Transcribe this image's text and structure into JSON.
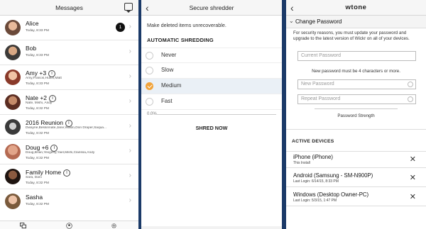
{
  "messages": {
    "title": "Messages",
    "rows": [
      {
        "name": "Alice",
        "members": "",
        "time": "Today, 8:33 PM",
        "badge": "1",
        "info": false
      },
      {
        "name": "Bob",
        "members": "",
        "time": "Today, 8:33 PM",
        "badge": "",
        "info": false
      },
      {
        "name": "Amy +3",
        "members": "Amy,Francis,Hutch,Matt",
        "time": "Today, 8:33 PM",
        "badge": "",
        "info": true
      },
      {
        "name": "Nate +2",
        "members": "Nate, Mishi, Andy",
        "time": "Today, 8:32 PM",
        "badge": "",
        "info": true
      },
      {
        "name": "2016 Reunion",
        "members": "Dwayne,Bessinnate,Jane,Waldo,Don Draper,Saqua...",
        "time": "Today, 8:32 PM",
        "badge": "",
        "info": true
      },
      {
        "name": "Doug +6",
        "members": "Doug,Brian,Yevgeny,Yael,Mishi,Clarissa,Andy",
        "time": "Today, 8:32 PM",
        "badge": "",
        "info": true
      },
      {
        "name": "Family Home",
        "members": "Sara, Dani",
        "time": "Today, 8:32 PM",
        "badge": "",
        "info": true
      },
      {
        "name": "Sasha",
        "members": "",
        "time": "Today, 8:32 PM",
        "badge": "",
        "info": false
      }
    ],
    "tabs": [
      "chat-bubbles-icon",
      "profile-icon",
      "settings-gear-icon"
    ]
  },
  "shredder": {
    "title": "Secure shredder",
    "description": "Make deleted items unrecoverable.",
    "section": "AUTOMATIC SHREDDING",
    "options": [
      "Never",
      "Slow",
      "Medium",
      "Fast"
    ],
    "selected_option": "Medium",
    "progress_label": "0.0%",
    "progress": 0.0,
    "action": "SHRED NOW"
  },
  "account": {
    "title": "wtone",
    "section": "Change Password",
    "notice": "For security reasons, you must update your password and upgrade to the latest version of Wickr on all of your devices.",
    "current_placeholder": "Current Password",
    "rule": "New password must be 4 characters or more.",
    "new_placeholder": "New Password",
    "repeat_placeholder": "Repeat Password",
    "strength_label": "Password Strength",
    "devices_title": "ACTIVE DEVICES",
    "devices": [
      {
        "name": "iPhone (iPhone)",
        "detail": "This Install"
      },
      {
        "name": "Android (Samsung - SM-N900P)",
        "detail": "Last Login: 6/14/15, 8:33 PM"
      },
      {
        "name": "Windows (Desktop Owner-PC)",
        "detail": "Last Login: 5/3/15, 1:47 PM"
      }
    ]
  },
  "colors": {
    "background": "#1b3a68",
    "accent": "#f1a33a",
    "selected_row": "#eaf0f6"
  }
}
